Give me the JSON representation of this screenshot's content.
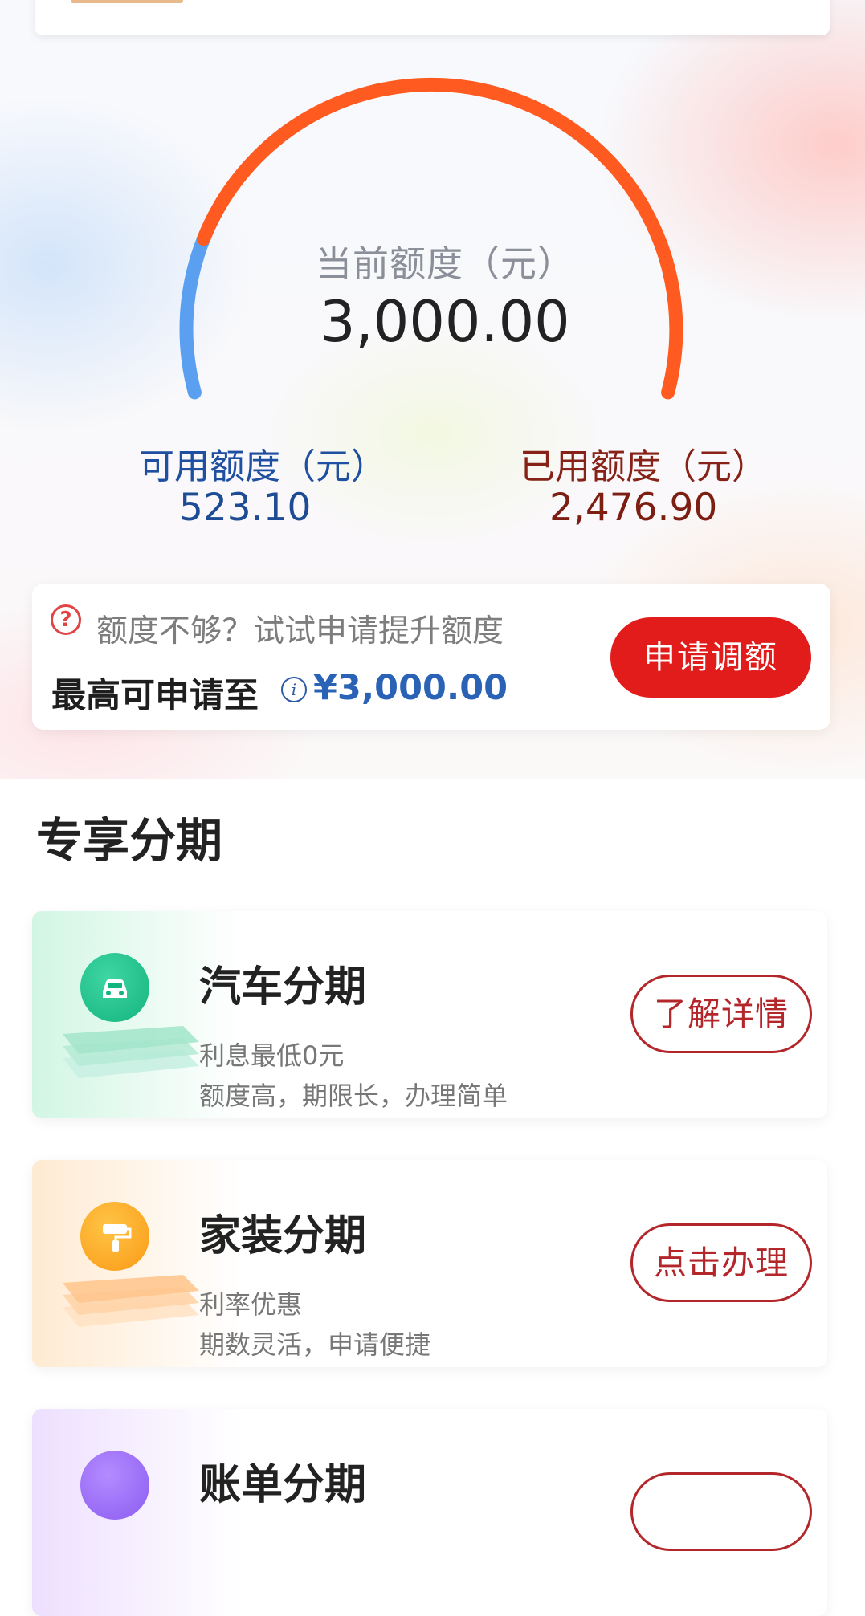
{
  "colors": {
    "accent_red": "#e21b1b",
    "available_blue": "#5a9ff0",
    "used_orange": "#ff5a1f",
    "link_blue": "#2a63b5"
  },
  "gauge": {
    "label": "当前额度（元）",
    "value": "3,000.00",
    "available_label": "可用额度（元）",
    "available_value": "523.10",
    "used_label": "已用额度（元）",
    "used_value": "2,476.90",
    "available_fraction": 0.1744
  },
  "raise": {
    "hint": "额度不够？试试申请提升额度",
    "max_label": "最高可申请至",
    "max_value": "¥3,000.00",
    "apply_label": "申请调额",
    "question_icon": "question-icon",
    "info_icon": "info-icon"
  },
  "section": {
    "title": "专享分期"
  },
  "loans": [
    {
      "title": "汽车分期",
      "line1": "利息最低0元",
      "line2": "额度高，期限长，办理简单",
      "button": "了解详情",
      "icon": "car-icon"
    },
    {
      "title": "家装分期",
      "line1": "利率优惠",
      "line2": "期数灵活，申请便捷",
      "button": "点击办理",
      "icon": "paint-roller-icon"
    },
    {
      "title": "账单分期",
      "icon": "bill-icon"
    }
  ]
}
